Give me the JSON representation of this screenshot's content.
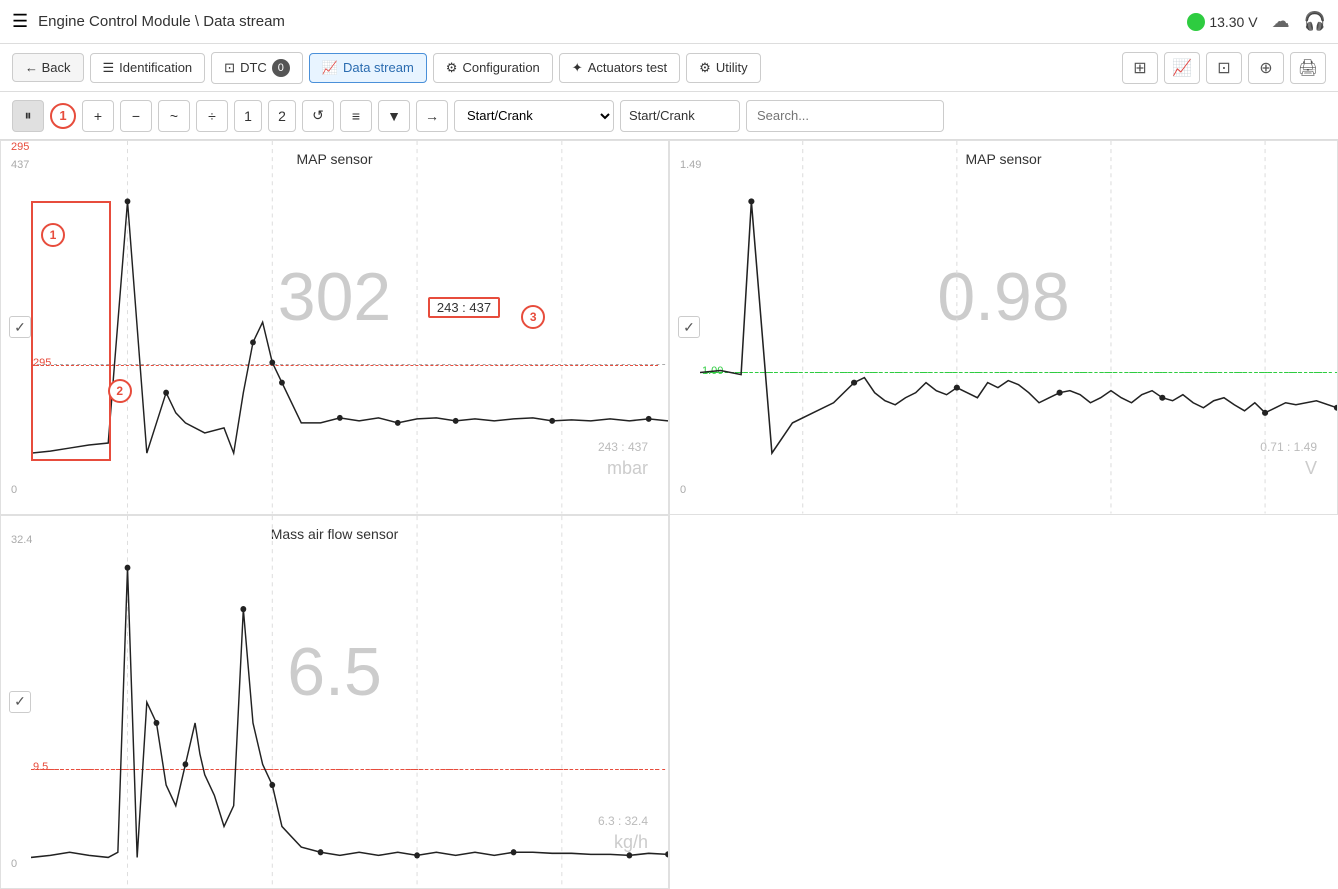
{
  "titlebar": {
    "hamburger": "☰",
    "title": "Engine Control Module \\ Data stream",
    "voltage": "13.30 V",
    "cloud_icon": "☁",
    "headphone_icon": "🎧"
  },
  "navbar": {
    "back": "← Back",
    "identification": "Identification",
    "dtc": "DTC",
    "dtc_count": "0",
    "data_stream": "Data stream",
    "configuration": "Configuration",
    "actuators_test": "Actuators test",
    "utility": "Utility",
    "icons": [
      "⊞",
      "📈",
      "⊡",
      "⊕",
      "🖨"
    ]
  },
  "toolbar": {
    "pause_icon": "⏸",
    "badge1": "1",
    "plus": "+",
    "minus": "−",
    "wave": "~",
    "divider": "÷",
    "num1": "1",
    "num2": "2",
    "refresh": "↺",
    "menu": "≡",
    "filter": "▼",
    "arrow": "→",
    "select_value": "Start/Crank",
    "label_value": "Start/Crank",
    "search_placeholder": "Search..."
  },
  "charts": {
    "top_left": {
      "title": "MAP sensor",
      "value": "302",
      "unit": "mbar",
      "range": "243 : 437",
      "y_max": "437",
      "y_zero": "0",
      "y_mark": "295",
      "dotted_y_pct": 77,
      "annot1": {
        "label": "1",
        "x_pct": 7,
        "y_pct": 24
      },
      "annot2": {
        "label": "2",
        "x_pct": 17,
        "y_pct": 68
      },
      "annot3": {
        "label": "3",
        "x_pct": 80,
        "y_pct": 48
      },
      "tooltip": "243 : 437"
    },
    "top_right": {
      "title": "MAP sensor",
      "value": "0.98",
      "unit": "V",
      "range": "0.71 : 1.49",
      "y_max": "1.49",
      "y_zero": "0",
      "y_mark": "1.00",
      "dotted_y_pct": 67
    },
    "bottom_left": {
      "title": "Mass air flow sensor",
      "value": "6.5",
      "unit": "kg/h",
      "range": "6.3 : 32.4",
      "y_max": "32.4",
      "y_zero": "0",
      "y_mark": "9.5",
      "dotted_y_pct": 71
    }
  }
}
